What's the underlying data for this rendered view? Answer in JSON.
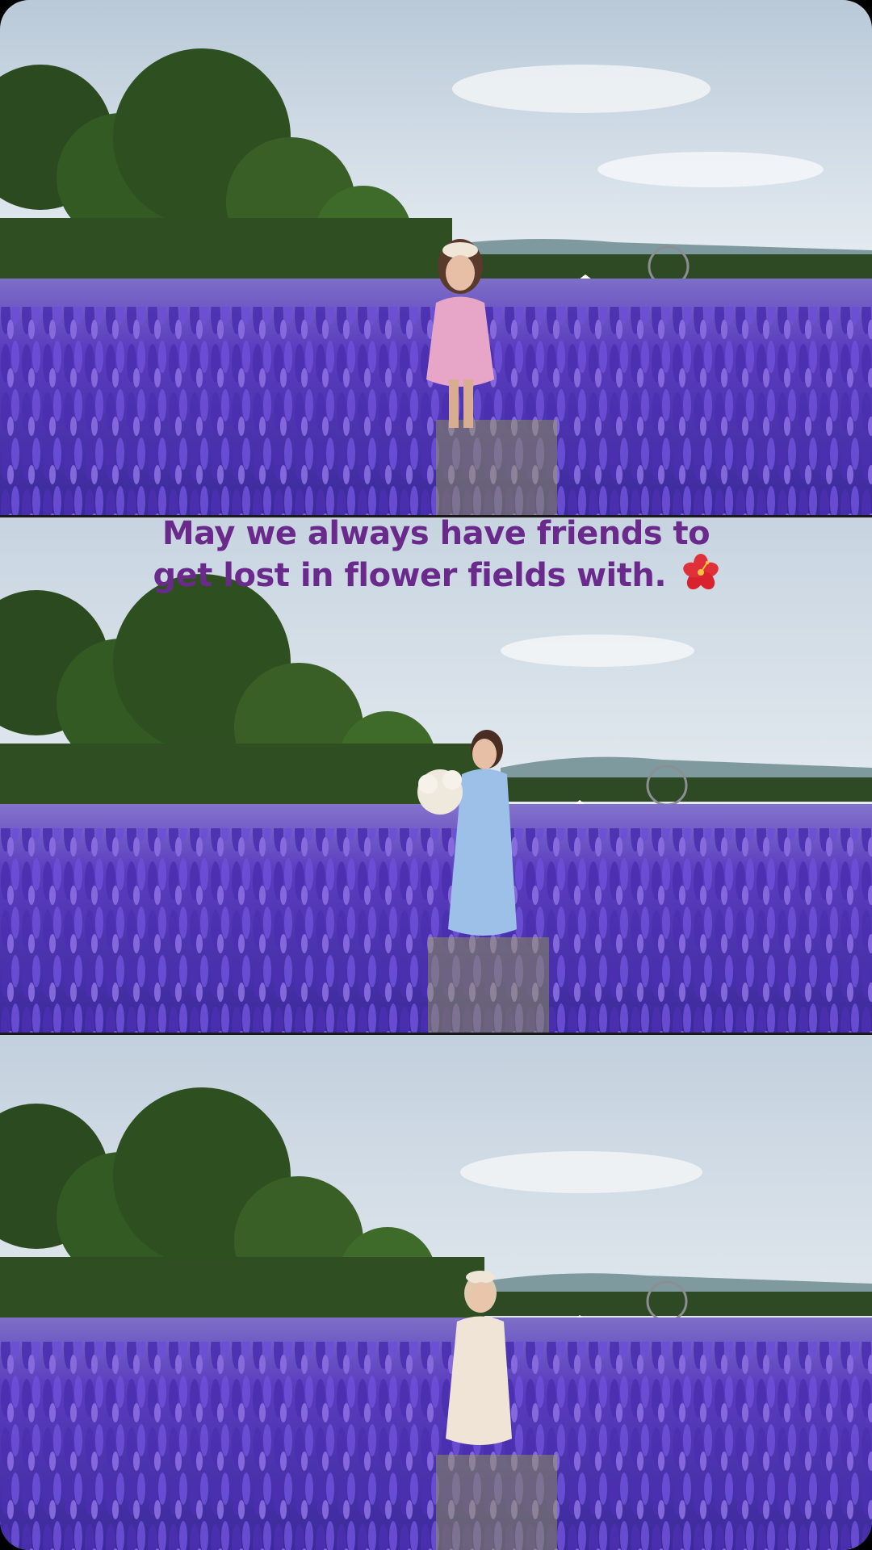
{
  "caption": {
    "line1": "May we always have friends to",
    "line2": "get lost in flower fields with.",
    "emoji": "hibiscus-icon"
  },
  "panels": [
    {
      "subject": "woman in pink dress",
      "dress_color": "#e7a6c8"
    },
    {
      "subject": "woman in light blue dress holding bouquet",
      "dress_color": "#9cc0e8"
    },
    {
      "subject": "woman in white floral dress",
      "dress_color": "#efe4d6"
    }
  ],
  "colors": {
    "sky": "#dde6ee",
    "flowers": "#5a3cbf",
    "caption": "#6a2a8c"
  }
}
